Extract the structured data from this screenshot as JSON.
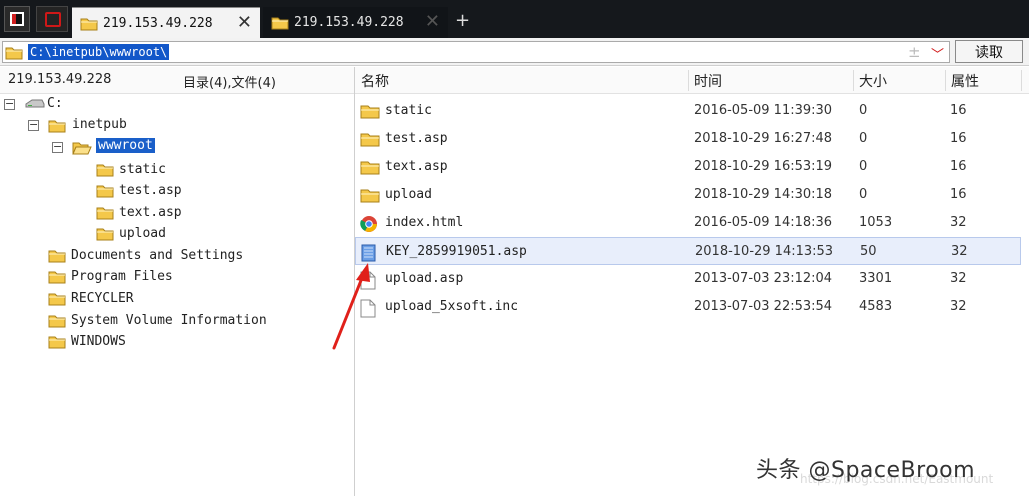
{
  "tabs": [
    {
      "label": "219.153.49.228",
      "active": true
    },
    {
      "label": "219.153.49.228",
      "active": false
    }
  ],
  "new_tab_label": "+",
  "path_bar": {
    "value": "C:\\inetpub\\wwwroot\\",
    "read_button": "读取",
    "plus_symbol": "±"
  },
  "left_header": {
    "host": "219.153.49.228",
    "counts": "目录(4),文件(4)"
  },
  "columns": {
    "name": "名称",
    "time": "时间",
    "size": "大小",
    "attr": "属性"
  },
  "tree": {
    "drive": "C:",
    "inetpub": "inetpub",
    "wwwroot": "wwwroot",
    "children": [
      "static",
      "test.asp",
      "text.asp",
      "upload"
    ],
    "root_folders": [
      "Documents and Settings",
      "Program Files",
      "RECYCLER",
      "System Volume Information",
      "WINDOWS"
    ]
  },
  "files": [
    {
      "name": "static",
      "time": "2016-05-09 11:39:30",
      "size": "0",
      "attr": "16",
      "icon": "folder-icon"
    },
    {
      "name": "test.asp",
      "time": "2018-10-29 16:27:48",
      "size": "0",
      "attr": "16",
      "icon": "folder-icon"
    },
    {
      "name": "text.asp",
      "time": "2018-10-29 16:53:19",
      "size": "0",
      "attr": "16",
      "icon": "folder-icon"
    },
    {
      "name": "upload",
      "time": "2018-10-29 14:30:18",
      "size": "0",
      "attr": "16",
      "icon": "folder-icon"
    },
    {
      "name": "index.html",
      "time": "2016-05-09 14:18:36",
      "size": "1053",
      "attr": "32",
      "icon": "chrome-icon"
    },
    {
      "name": "KEY_2859919051.asp",
      "time": "2018-10-29 14:13:53",
      "size": "50",
      "attr": "32",
      "icon": "asp-file-icon",
      "selected": true
    },
    {
      "name": "upload.asp",
      "time": "2013-07-03 23:12:04",
      "size": "3301",
      "attr": "32",
      "icon": "file-icon"
    },
    {
      "name": "upload_5xsoft.inc",
      "time": "2013-07-03 22:53:54",
      "size": "4583",
      "attr": "32",
      "icon": "file-icon"
    }
  ],
  "watermark": "头条 @SpaceBroom",
  "colors": {
    "tabbar_bg": "#15181c",
    "selection_blue": "#1a5fc9",
    "arrow_red": "#e0201a",
    "folder_yellow": "#f0c040"
  }
}
